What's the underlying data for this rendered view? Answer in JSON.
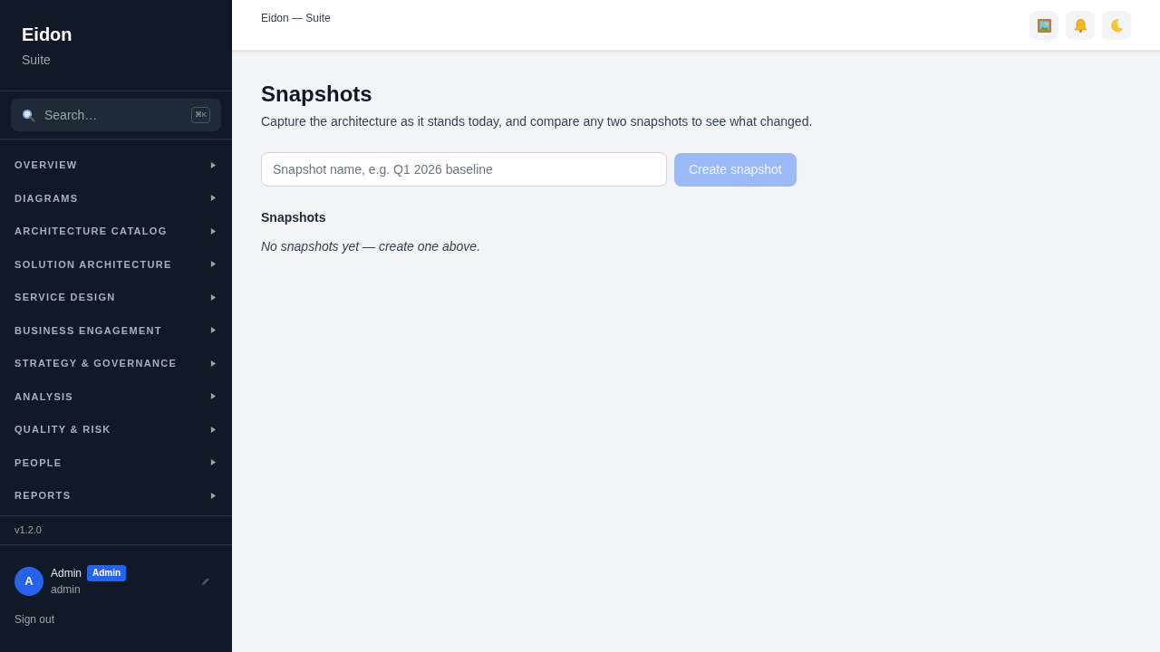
{
  "sidebar": {
    "brand": {
      "title": "Eidon",
      "subtitle": "Suite"
    },
    "search": {
      "label": "Search…",
      "shortcut": "⌘K"
    },
    "nav_items": [
      {
        "label": "OVERVIEW",
        "expanded": false
      },
      {
        "label": "DIAGRAMS",
        "expanded": false
      },
      {
        "label": "ARCHITECTURE CATALOG",
        "expanded": false
      },
      {
        "label": "SOLUTION ARCHITECTURE",
        "expanded": false
      },
      {
        "label": "SERVICE DESIGN",
        "expanded": false
      },
      {
        "label": "BUSINESS ENGAGEMENT",
        "expanded": false
      },
      {
        "label": "STRATEGY & GOVERNANCE",
        "expanded": false
      },
      {
        "label": "ANALYSIS",
        "expanded": false
      },
      {
        "label": "QUALITY & RISK",
        "expanded": false
      },
      {
        "label": "PEOPLE",
        "expanded": false
      },
      {
        "label": "REPORTS",
        "expanded": false
      }
    ],
    "version": "v1.2.0",
    "user": {
      "avatar_initial": "A",
      "name": "Admin",
      "role_badge": "Admin",
      "username": "admin"
    },
    "sign_out": "Sign out"
  },
  "header": {
    "breadcrumb": "Eidon — Suite"
  },
  "page": {
    "title": "Snapshots",
    "description": "Capture the architecture as it stands today, and compare any two snapshots to see what changed.",
    "name_field": {
      "placeholder": "Snapshot name, e.g. Q1 2026 baseline"
    },
    "create_button": {
      "label": "Create snapshot",
      "disabled": true
    },
    "list_heading": "Snapshots",
    "empty_message": "No snapshots yet — create one above."
  }
}
